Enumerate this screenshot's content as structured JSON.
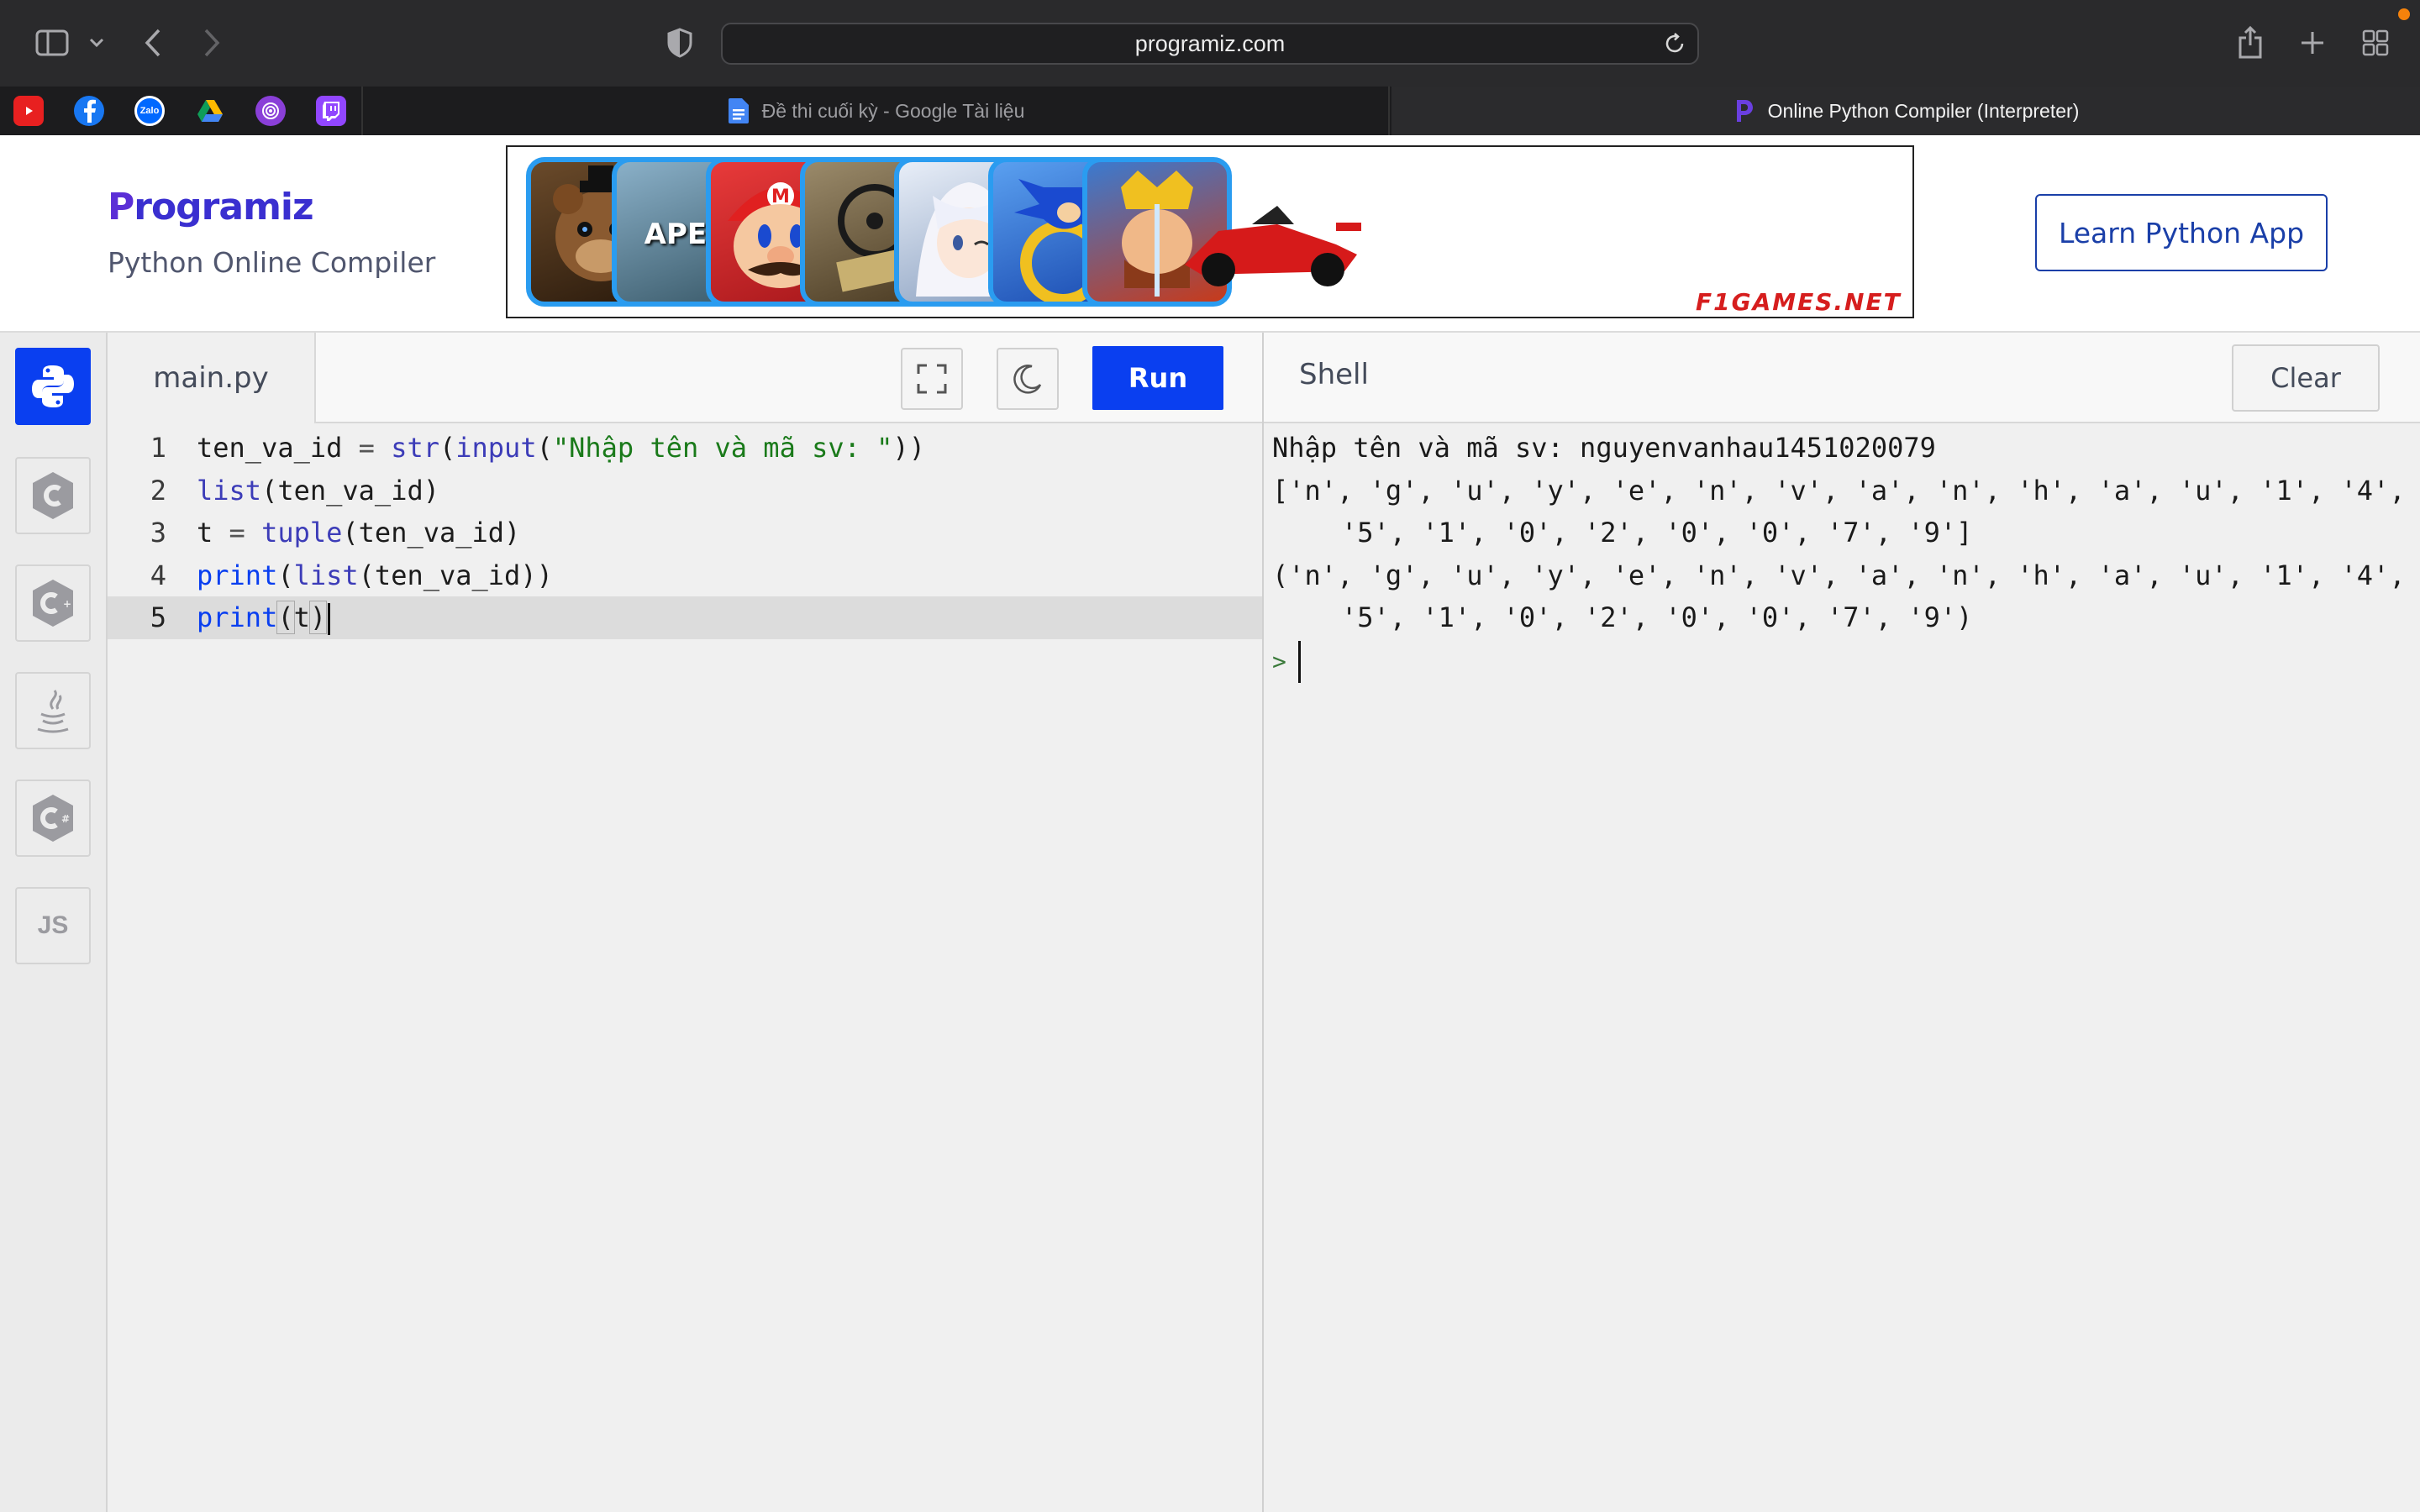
{
  "browser": {
    "url": "programiz.com",
    "tabs": [
      {
        "title": "Đề thi cuối kỳ - Google Tài liệu",
        "active": false
      },
      {
        "title": "Online Python Compiler (Interpreter)",
        "active": true
      }
    ],
    "favorites": [
      "youtube-icon",
      "facebook-icon",
      "zalo-icon",
      "google-drive-icon",
      "podcasts-icon",
      "twitch-icon"
    ],
    "favorites_text": {
      "zalo": "Zalo"
    }
  },
  "header": {
    "logo": "Programiz",
    "logo_first": "P",
    "logo_rest": "rogramiz",
    "subtitle": "Python Online Compiler",
    "learn_button": "Learn Python App",
    "ad": {
      "games": [
        {
          "icon": "freddy-icon",
          "color": "#3a2a1c",
          "label": ""
        },
        {
          "icon": "apex-icon",
          "color": "#5a7a8a",
          "label": "APEX"
        },
        {
          "icon": "mario-icon",
          "color": "#d8242a",
          "label": ""
        },
        {
          "icon": "state-of-decay-icon",
          "color": "#6a5a3a",
          "label": ""
        },
        {
          "icon": "anime-girl-icon",
          "color": "#b8c8e0",
          "label": ""
        },
        {
          "icon": "sonic-icon",
          "color": "#3a6ad0",
          "label": ""
        },
        {
          "icon": "clash-royale-icon",
          "color": "#8a4a2a",
          "label": ""
        }
      ],
      "brand": "F1GAMES.NET"
    }
  },
  "languages": [
    "python-icon",
    "c-icon",
    "cpp-icon",
    "java-icon",
    "csharp-icon",
    "js-icon"
  ],
  "languages_text": {
    "js": "JS"
  },
  "editor": {
    "filename": "main.py",
    "run_label": "Run",
    "lines": [
      {
        "n": "1"
      },
      {
        "n": "2"
      },
      {
        "n": "3"
      },
      {
        "n": "4"
      },
      {
        "n": "5"
      }
    ],
    "code": {
      "l1_var": "ten_va_id",
      "l1_eq": " = ",
      "l1_str": "str",
      "l1_p1": "(",
      "l1_input": "input",
      "l1_p2": "(",
      "l1_lit": "\"Nhập tên và mã sv: \"",
      "l1_close": "))",
      "l2_list": "list",
      "l2_rest": "(ten_va_id)",
      "l3_t": "t",
      "l3_eq": " = ",
      "l3_tuple": "tuple",
      "l3_rest": "(ten_va_id)",
      "l4_print": "print",
      "l4_p": "(",
      "l4_list": "list",
      "l4_rest": "(ten_va_id))",
      "l5_print": "print",
      "l5_p": "(",
      "l5_t": "t",
      "l5_close": ")"
    }
  },
  "shell": {
    "title": "Shell",
    "clear_label": "Clear",
    "output": [
      "Nhập tên và mã sv: nguyenvanhau1451020079",
      "['n', 'g', 'u', 'y', 'e', 'n', 'v', 'a', 'n', 'h', 'a', 'u', '1', '4',",
      "'5', '1', '0', '2', '0', '0', '7', '9']",
      "('n', 'g', 'u', 'y', 'e', 'n', 'v', 'a', 'n', 'h', 'a', 'u', '1', '4',",
      "'5', '1', '0', '2', '0', '0', '7', '9')"
    ],
    "prompt": ">"
  },
  "colors": {
    "accent": "#0a3ff0",
    "learn_button_border": "#1a3fa8",
    "toolbar": "#2a2a2c"
  }
}
